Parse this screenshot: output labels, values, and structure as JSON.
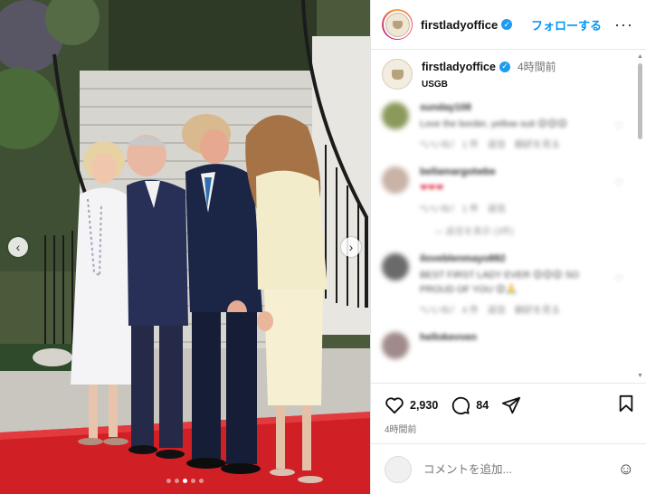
{
  "header": {
    "username": "firstladyoffice",
    "follow_label": "フォローする",
    "more_label": "···"
  },
  "caption": {
    "username": "firstladyoffice",
    "time": "4時間前",
    "text": "USGB"
  },
  "comments": [
    {
      "name": "sunday108",
      "text": "Love the border, yellow suit 😊😊😊",
      "meta": "*いいね！ 1 件　返信　翻訳を見る",
      "avatar_color": "#8a9a5a"
    },
    {
      "name": "bellamargotwbe",
      "text": "❤❤❤",
      "meta": "*いいね！ 1 件　返信",
      "avatar_color": "#c9b2a6",
      "replies": "— 返信を表示 (3件)"
    },
    {
      "name": "iloveblenmayo882",
      "text": "BEST FIRST LADY EVER 😊😊😊 SO PROUD OF YOU 😊🙏",
      "meta": "*いいね！ 4 件　返信　翻訳を見る",
      "avatar_color": "#6a6a6a"
    },
    {
      "name": "hellokevven",
      "text": "",
      "meta": "",
      "avatar_color": "#a08a8a"
    }
  ],
  "actions": {
    "likes": "2,930",
    "comments": "84",
    "posted": "4時間前"
  },
  "comment_bar": {
    "placeholder": "コメントを追加..."
  },
  "photo": {
    "prev_label": "‹",
    "next_label": "›",
    "slide_count": 5,
    "active_slide": 3
  },
  "colors": {
    "accent": "#0095f6",
    "carpet": "#d01f25"
  }
}
